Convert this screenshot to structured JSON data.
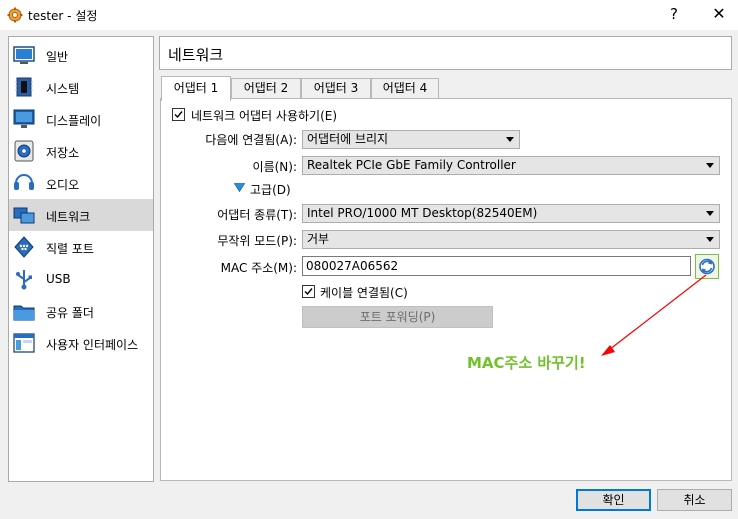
{
  "window": {
    "title": "tester - 설정",
    "help_label": "?",
    "close_label": "✕"
  },
  "sidebar": {
    "items": [
      {
        "label": "일반",
        "icon": "general-icon"
      },
      {
        "label": "시스템",
        "icon": "system-icon"
      },
      {
        "label": "디스플레이",
        "icon": "display-icon"
      },
      {
        "label": "저장소",
        "icon": "storage-icon"
      },
      {
        "label": "오디오",
        "icon": "audio-icon"
      },
      {
        "label": "네트워크",
        "icon": "network-icon",
        "selected": true
      },
      {
        "label": "직렬 포트",
        "icon": "serial-port-icon"
      },
      {
        "label": "USB",
        "icon": "usb-icon"
      },
      {
        "label": "공유 폴더",
        "icon": "shared-folder-icon"
      },
      {
        "label": "사용자 인터페이스",
        "icon": "user-interface-icon"
      }
    ]
  },
  "header": {
    "title": "네트워크"
  },
  "tabs": [
    {
      "label": "어댑터 1",
      "active": true
    },
    {
      "label": "어댑터 2"
    },
    {
      "label": "어댑터 3"
    },
    {
      "label": "어댑터 4"
    }
  ],
  "form": {
    "enable_adapter": {
      "label": "네트워크 어댑터 사용하기(E)",
      "checked": true
    },
    "attached_to": {
      "label": "다음에 연결됨(A):",
      "value": "어댑터에 브리지"
    },
    "name": {
      "label": "이름(N):",
      "value": "Realtek PCIe GbE Family Controller"
    },
    "advanced": {
      "label": "고급(D)"
    },
    "adapter_type": {
      "label": "어댑터 종류(T):",
      "value": "Intel PRO/1000 MT Desktop(82540EM)"
    },
    "promiscuous": {
      "label": "무작위 모드(P):",
      "value": "거부"
    },
    "mac": {
      "label": "MAC 주소(M):",
      "value": "080027A06562",
      "refresh_icon": "refresh-icon"
    },
    "cable": {
      "label": "케이블 연결됨(C)",
      "checked": true
    },
    "port_forward": {
      "label": "포트 포워딩(P)"
    }
  },
  "annotation": {
    "text": "MAC주소 바꾸기!",
    "color": "#70c22a",
    "arrow_color": "#ff0000"
  },
  "buttons": {
    "ok": "확인",
    "cancel": "취소"
  },
  "colors": {
    "accent": "#0078d7",
    "selected_row": "#d9d9d9"
  }
}
